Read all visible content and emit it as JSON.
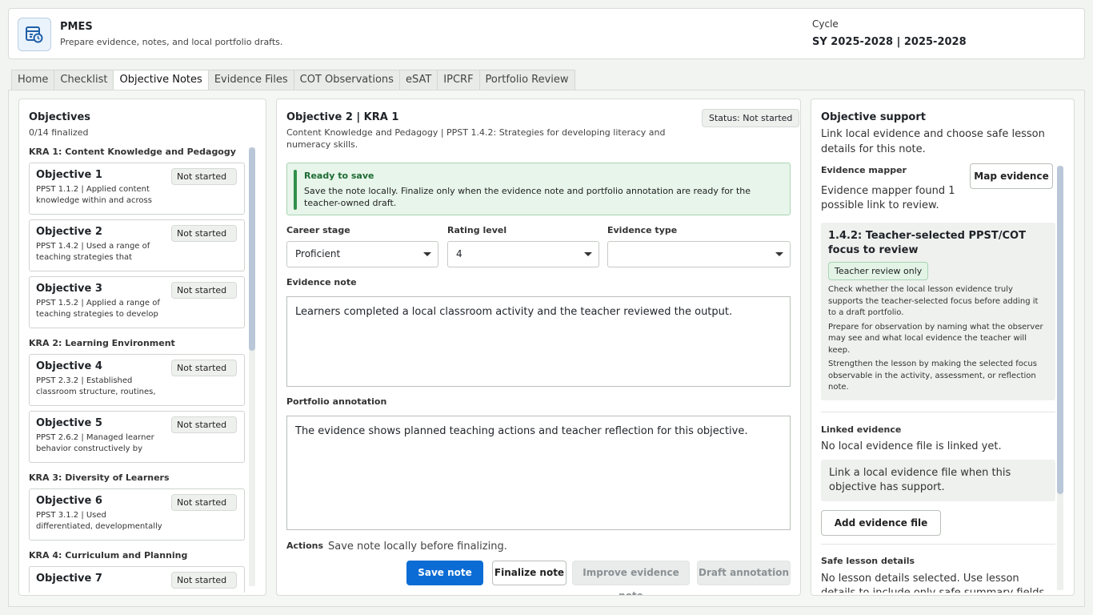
{
  "header": {
    "app_name": "PMES",
    "tagline": "Prepare evidence, notes, and local portfolio drafts.",
    "logo_icon": "dashboard-clock-icon",
    "cycle_label": "Cycle",
    "cycle_value": "SY 2025-2028 | 2025-2028"
  },
  "tabs": [
    {
      "label": "Home"
    },
    {
      "label": "Checklist"
    },
    {
      "label": "Objective Notes",
      "active": true
    },
    {
      "label": "Evidence Files"
    },
    {
      "label": "COT Observations"
    },
    {
      "label": "eSAT"
    },
    {
      "label": "IPCRF"
    },
    {
      "label": "Portfolio Review"
    }
  ],
  "objectives_panel": {
    "title": "Objectives",
    "progress": "0/14 finalized",
    "groups": [
      {
        "heading": "KRA 1: Content Knowledge and Pedagogy",
        "items": [
          {
            "name": "Objective 1",
            "status": "Not started",
            "desc": "PPST 1.1.2 | Applied content knowledge within and across"
          },
          {
            "name": "Objective 2",
            "status": "Not started",
            "desc": "PPST 1.4.2 | Used a range of teaching strategies that enhance"
          },
          {
            "name": "Objective 3",
            "status": "Not started",
            "desc": "PPST 1.5.2 | Applied a range of teaching strategies to develop"
          }
        ]
      },
      {
        "heading": "KRA 2: Learning Environment",
        "items": [
          {
            "name": "Objective 4",
            "status": "Not started",
            "desc": "PPST 2.3.2 | Established classroom structure, routines,"
          },
          {
            "name": "Objective 5",
            "status": "Not started",
            "desc": "PPST 2.6.2 | Managed learner behavior constructively by"
          }
        ]
      },
      {
        "heading": "KRA 3: Diversity of Learners",
        "items": [
          {
            "name": "Objective 6",
            "status": "Not started",
            "desc": "PPST 3.1.2 | Used differentiated, developmentally appropriate"
          }
        ]
      },
      {
        "heading": "KRA 4: Curriculum and Planning",
        "items": [
          {
            "name": "Objective 7",
            "status": "Not started",
            "desc": ""
          }
        ]
      }
    ]
  },
  "editor": {
    "title": "Objective 2 | KRA 1",
    "subtitle": "Content Knowledge and Pedagogy | PPST 1.4.2: Strategies for developing literacy and numeracy skills.",
    "status": "Status: Not started",
    "ready_title": "Ready to save",
    "ready_text": "Save the note locally. Finalize only when the evidence note and portfolio annotation are ready for the teacher-owned draft.",
    "career_stage_label": "Career stage",
    "career_stage_value": "Proficient",
    "rating_label": "Rating level",
    "rating_value": "4",
    "evidence_type_label": "Evidence type",
    "evidence_type_value": "",
    "evidence_note_label": "Evidence note",
    "evidence_note_value": "Learners completed a local classroom activity and the teacher reviewed the output.",
    "annotation_label": "Portfolio annotation",
    "annotation_value": "The evidence shows planned teaching actions and teacher reflection for this objective.",
    "actions_label": "Actions",
    "actions_hint": "Save note locally before finalizing.",
    "buttons": {
      "save": "Save note",
      "finalize": "Finalize note",
      "improve": "Improve evidence note",
      "draft": "Draft annotation"
    }
  },
  "support": {
    "title": "Objective support",
    "subtitle": "Link local evidence and choose safe lesson details for this note.",
    "mapper_label": "Evidence mapper",
    "map_button": "Map evidence",
    "mapper_result": "Evidence mapper found 1 possible link to review.",
    "focus_title": "1.4.2: Teacher-selected PPST/COT focus to review",
    "focus_pill": "Teacher review only",
    "focus_paragraphs": [
      "Check whether the local lesson evidence truly supports the teacher-selected focus before adding it to a draft portfolio.",
      "Prepare for observation by naming what the observer may see and what local evidence the teacher will keep.",
      "Strengthen the lesson by making the selected focus observable in the activity, assessment, or reflection note."
    ],
    "linked_label": "Linked evidence",
    "linked_text": "No local evidence file is linked yet.",
    "linked_hint": "Link a local evidence file when this objective has support.",
    "add_button": "Add evidence file",
    "safe_label": "Safe lesson details",
    "safe_text": "No lesson details selected. Use lesson details to include only safe summary fields."
  },
  "colors": {
    "primary": "#0a6cd4",
    "ready_bg": "#e7f5ea",
    "ready_accent": "#2f8f4a"
  }
}
